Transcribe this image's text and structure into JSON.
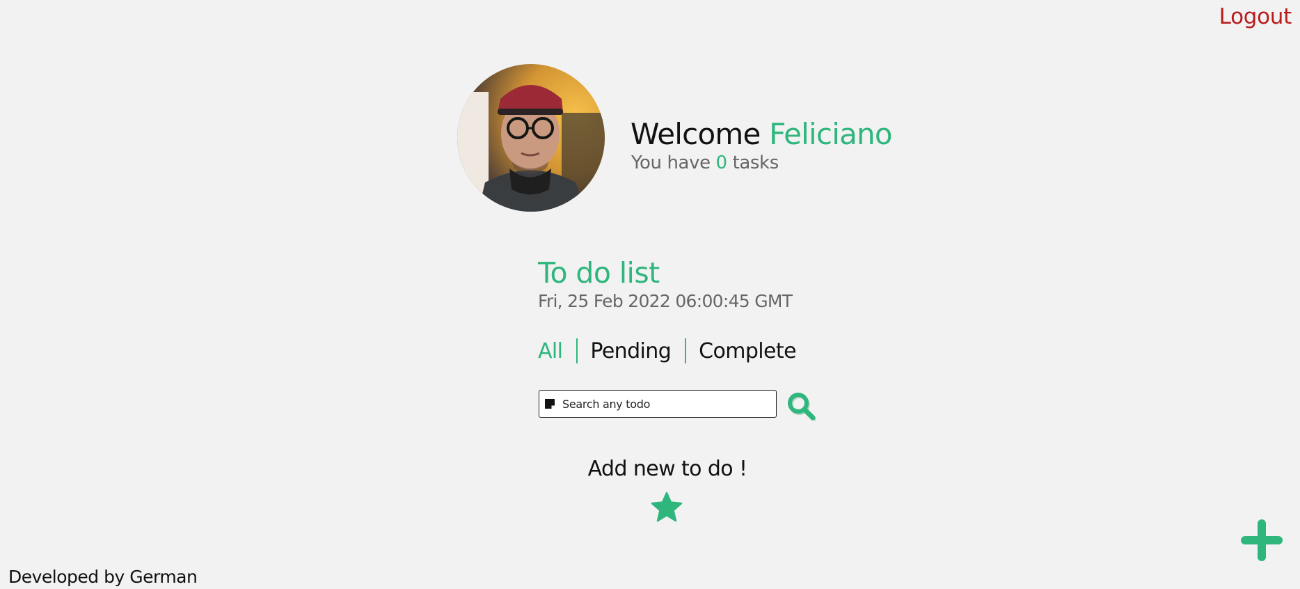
{
  "header": {
    "logout_label": "Logout"
  },
  "profile": {
    "welcome_prefix": "Welcome ",
    "user_name": "Feliciano",
    "tasks_prefix": "You have ",
    "task_count": "0",
    "tasks_suffix": " tasks"
  },
  "todo": {
    "title": "To do list",
    "date": "Fri, 25 Feb 2022 06:00:45 GMT"
  },
  "filters": {
    "all": "All",
    "pending": "Pending",
    "complete": "Complete",
    "active": "All"
  },
  "search": {
    "placeholder": "Search any todo",
    "value": ""
  },
  "add_prompt": "Add new to do !",
  "footer": {
    "credit": "Developed by German"
  },
  "icons": {
    "note": "sticky-note-icon",
    "search": "magnifier-icon",
    "star": "star-icon",
    "add": "plus-icon"
  },
  "colors": {
    "accent": "#2eb67d",
    "logout": "#b91c1c",
    "background": "#f2f2f2",
    "text": "#111111",
    "muted": "#666666"
  }
}
